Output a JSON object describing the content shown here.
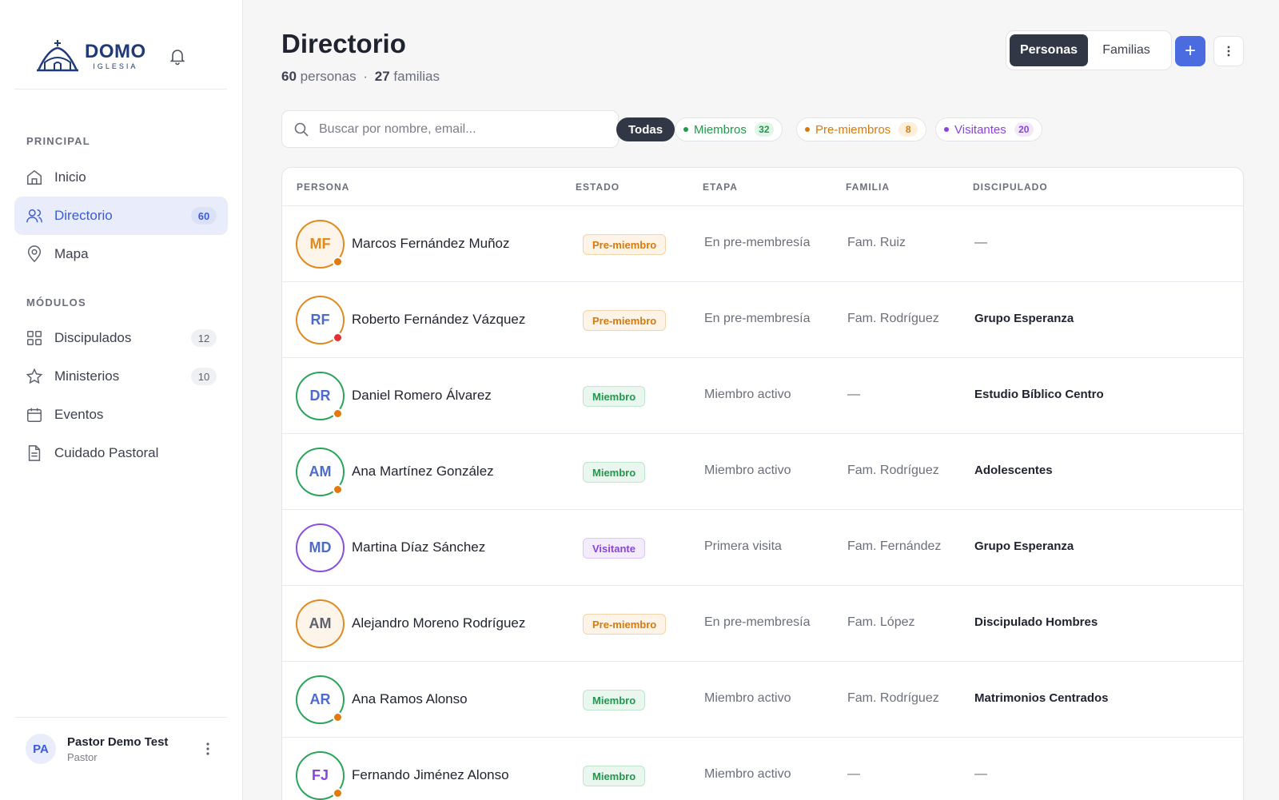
{
  "brand": {
    "name": "DOMO",
    "sub": "IGLESIA"
  },
  "sidebar": {
    "section_principal": "PRINCIPAL",
    "section_modulos": "MÓDULOS",
    "items": [
      {
        "label": "Inicio",
        "count": ""
      },
      {
        "label": "Directorio",
        "count": "60"
      },
      {
        "label": "Mapa",
        "count": ""
      },
      {
        "label": "Discipulados",
        "count": "12"
      },
      {
        "label": "Ministerios",
        "count": "10"
      },
      {
        "label": "Eventos",
        "count": ""
      },
      {
        "label": "Cuidado Pastoral",
        "count": ""
      }
    ],
    "user": {
      "initials": "PA",
      "name": "Pastor Demo Test",
      "role": "Pastor"
    }
  },
  "header": {
    "title": "Directorio",
    "personas_count": "60",
    "personas_label": "personas",
    "separator": "·",
    "familias_count": "27",
    "familias_label": "familias",
    "toggle_personas": "Personas",
    "toggle_familias": "Familias",
    "add_label": "+"
  },
  "search": {
    "placeholder": "Buscar por nombre, email..."
  },
  "filters": {
    "all": "Todas",
    "miembros": {
      "label": "Miembros",
      "count": "32"
    },
    "preMiembros": {
      "label": "Pre-miembros",
      "count": "8"
    },
    "visitantes": {
      "label": "Visitantes",
      "count": "20"
    }
  },
  "table": {
    "headers": {
      "persona": "PERSONA",
      "estado": "ESTADO",
      "etapa": "ETAPA",
      "familia": "FAMILIA",
      "discipulado": "DISCIPULADO"
    },
    "rows": [
      {
        "initials": "MF",
        "name": "Marcos Fernández Muñoz",
        "estado": "Pre-miembro",
        "etapa": "En pre-membresía",
        "familia": "Fam. Ruiz",
        "discipulado": "—"
      },
      {
        "initials": "RF",
        "name": "Roberto Fernández Vázquez",
        "estado": "Pre-miembro",
        "etapa": "En pre-membresía",
        "familia": "Fam. Rodríguez",
        "discipulado": "Grupo Esperanza"
      },
      {
        "initials": "DR",
        "name": "Daniel Romero Álvarez",
        "estado": "Miembro",
        "etapa": "Miembro activo",
        "familia": "—",
        "discipulado": "Estudio Bíblico Centro"
      },
      {
        "initials": "AM",
        "name": "Ana Martínez González",
        "estado": "Miembro",
        "etapa": "Miembro activo",
        "familia": "Fam. Rodríguez",
        "discipulado": "Adolescentes"
      },
      {
        "initials": "MD",
        "name": "Martina Díaz Sánchez",
        "estado": "Visitante",
        "etapa": "Primera visita",
        "familia": "Fam. Fernández",
        "discipulado": "Grupo Esperanza"
      },
      {
        "initials": "AM",
        "name": "Alejandro Moreno Rodríguez",
        "estado": "Pre-miembro",
        "etapa": "En pre-membresía",
        "familia": "Fam. López",
        "discipulado": "Discipulado Hombres"
      },
      {
        "initials": "AR",
        "name": "Ana Ramos Alonso",
        "estado": "Miembro",
        "etapa": "Miembro activo",
        "familia": "Fam. Rodríguez",
        "discipulado": "Matrimonios Centrados"
      },
      {
        "initials": "FJ",
        "name": "Fernando Jiménez Alonso",
        "estado": "Miembro",
        "etapa": "Miembro activo",
        "familia": "—",
        "discipulado": "—"
      }
    ]
  },
  "colors": {
    "accent": "#3b5bd9",
    "pre": "#d57a10",
    "member": "#23974c",
    "visitor": "#8a44de",
    "pip_orange": "#e07a12",
    "pip_red": "#e0303a"
  }
}
